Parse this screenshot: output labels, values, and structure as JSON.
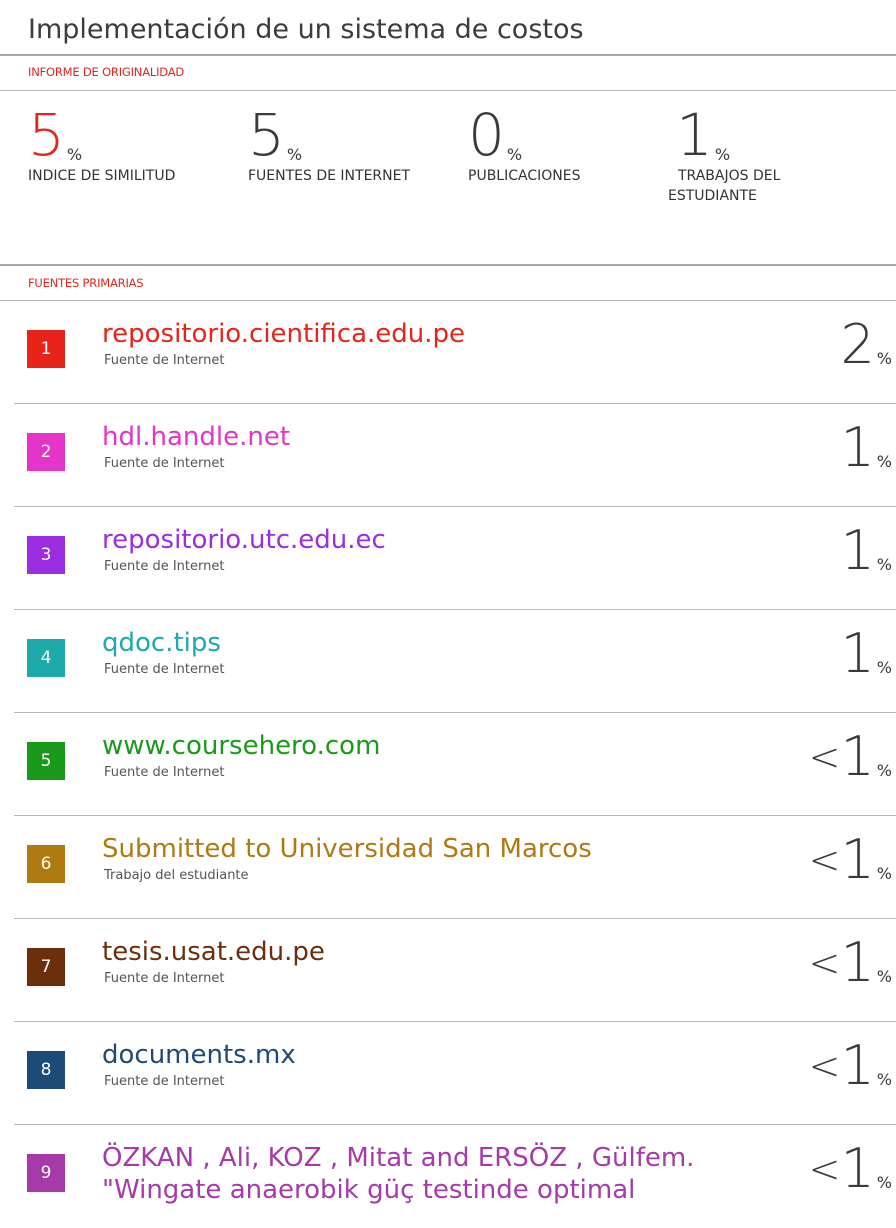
{
  "title": "Implementación de un sistema de costos",
  "report_label": "INFORME DE ORIGINALIDAD",
  "stats": [
    {
      "value": "5",
      "unit": "%",
      "label": "INDICE DE SIMILITUD",
      "color": "#e3261c"
    },
    {
      "value": "5",
      "unit": "%",
      "label": "FUENTES DE INTERNET",
      "color": "#3a3a3a"
    },
    {
      "value": "0",
      "unit": "%",
      "label": "PUBLICACIONES",
      "color": "#3a3a3a"
    },
    {
      "value": "1",
      "unit": "%",
      "label_line1": "TRABAJOS DEL",
      "label_line2": "ESTUDIANTE",
      "color": "#3a3a3a"
    }
  ],
  "primary_label": "FUENTES PRIMARIAS",
  "sources": [
    {
      "num": "1",
      "name": "repositorio.cientifica.edu.pe",
      "type": "Fuente de Internet",
      "prefix": "",
      "value": "2",
      "unit": "%",
      "color": "#e8231a"
    },
    {
      "num": "2",
      "name": "hdl.handle.net",
      "type": "Fuente de Internet",
      "prefix": "",
      "value": "1",
      "unit": "%",
      "color": "#e534c8"
    },
    {
      "num": "3",
      "name": "repositorio.utc.edu.ec",
      "type": "Fuente de Internet",
      "prefix": "",
      "value": "1",
      "unit": "%",
      "color": "#9b2de0"
    },
    {
      "num": "4",
      "name": "qdoc.tips",
      "type": "Fuente de Internet",
      "prefix": "",
      "value": "1",
      "unit": "%",
      "color": "#1eaaaa"
    },
    {
      "num": "5",
      "name": "www.coursehero.com",
      "type": "Fuente de Internet",
      "prefix": "<",
      "value": "1",
      "unit": "%",
      "color": "#1a9a1a"
    },
    {
      "num": "6",
      "name": "Submitted to Universidad San Marcos",
      "type": "Trabajo del estudiante",
      "prefix": "<",
      "value": "1",
      "unit": "%",
      "color": "#b07a12"
    },
    {
      "num": "7",
      "name": "tesis.usat.edu.pe",
      "type": "Fuente de Internet",
      "prefix": "<",
      "value": "1",
      "unit": "%",
      "color": "#6b2f0e"
    },
    {
      "num": "8",
      "name": "documents.mx",
      "type": "Fuente de Internet",
      "prefix": "<",
      "value": "1",
      "unit": "%",
      "color": "#1e4a78"
    },
    {
      "num": "9",
      "name": "ÖZKAN , Ali, KOZ , Mitat and ERSÖZ , Gülfem.",
      "name_line2": "\"Wingate anaerobik güç testinde optimal",
      "type": "",
      "prefix": "<",
      "value": "1",
      "unit": "%",
      "color": "#a53aa8"
    }
  ]
}
